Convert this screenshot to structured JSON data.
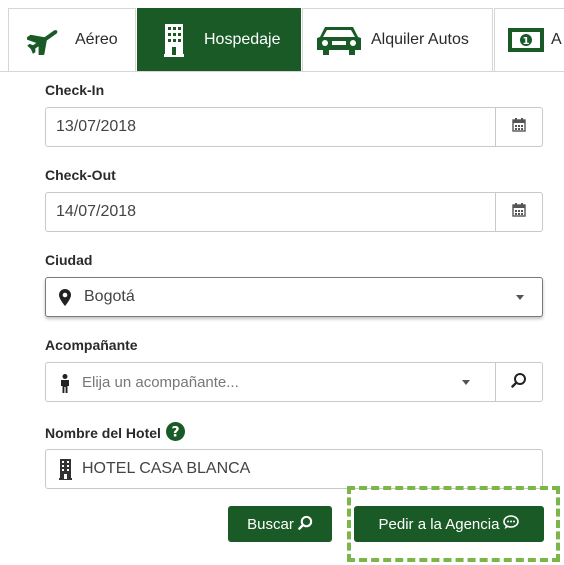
{
  "tabs": [
    {
      "label": "Aéreo",
      "icon": "plane-icon",
      "active": false
    },
    {
      "label": "Hospedaje",
      "icon": "building-icon",
      "active": true
    },
    {
      "label": "Alquiler Autos",
      "icon": "car-icon",
      "active": false
    },
    {
      "label": "A",
      "icon": "money-icon",
      "active": false
    }
  ],
  "form": {
    "checkin": {
      "label": "Check-In",
      "value": "13/07/2018",
      "icon": "calendar-icon"
    },
    "checkout": {
      "label": "Check-Out",
      "value": "14/07/2018",
      "icon": "calendar-icon"
    },
    "city": {
      "label": "Ciudad",
      "value": "Bogotá",
      "icon": "map-marker-icon"
    },
    "companion": {
      "label": "Acompañante",
      "placeholder": "Elija un acompañante...",
      "icon": "person-icon"
    },
    "hotel": {
      "label": "Nombre del Hotel",
      "value": "HOTEL CASA BLANCA",
      "icon": "building-icon"
    }
  },
  "buttons": {
    "search": "Buscar",
    "agency": "Pedir a la Agencia"
  },
  "colors": {
    "primary": "#1a5a26",
    "highlight": "#7ab648"
  }
}
